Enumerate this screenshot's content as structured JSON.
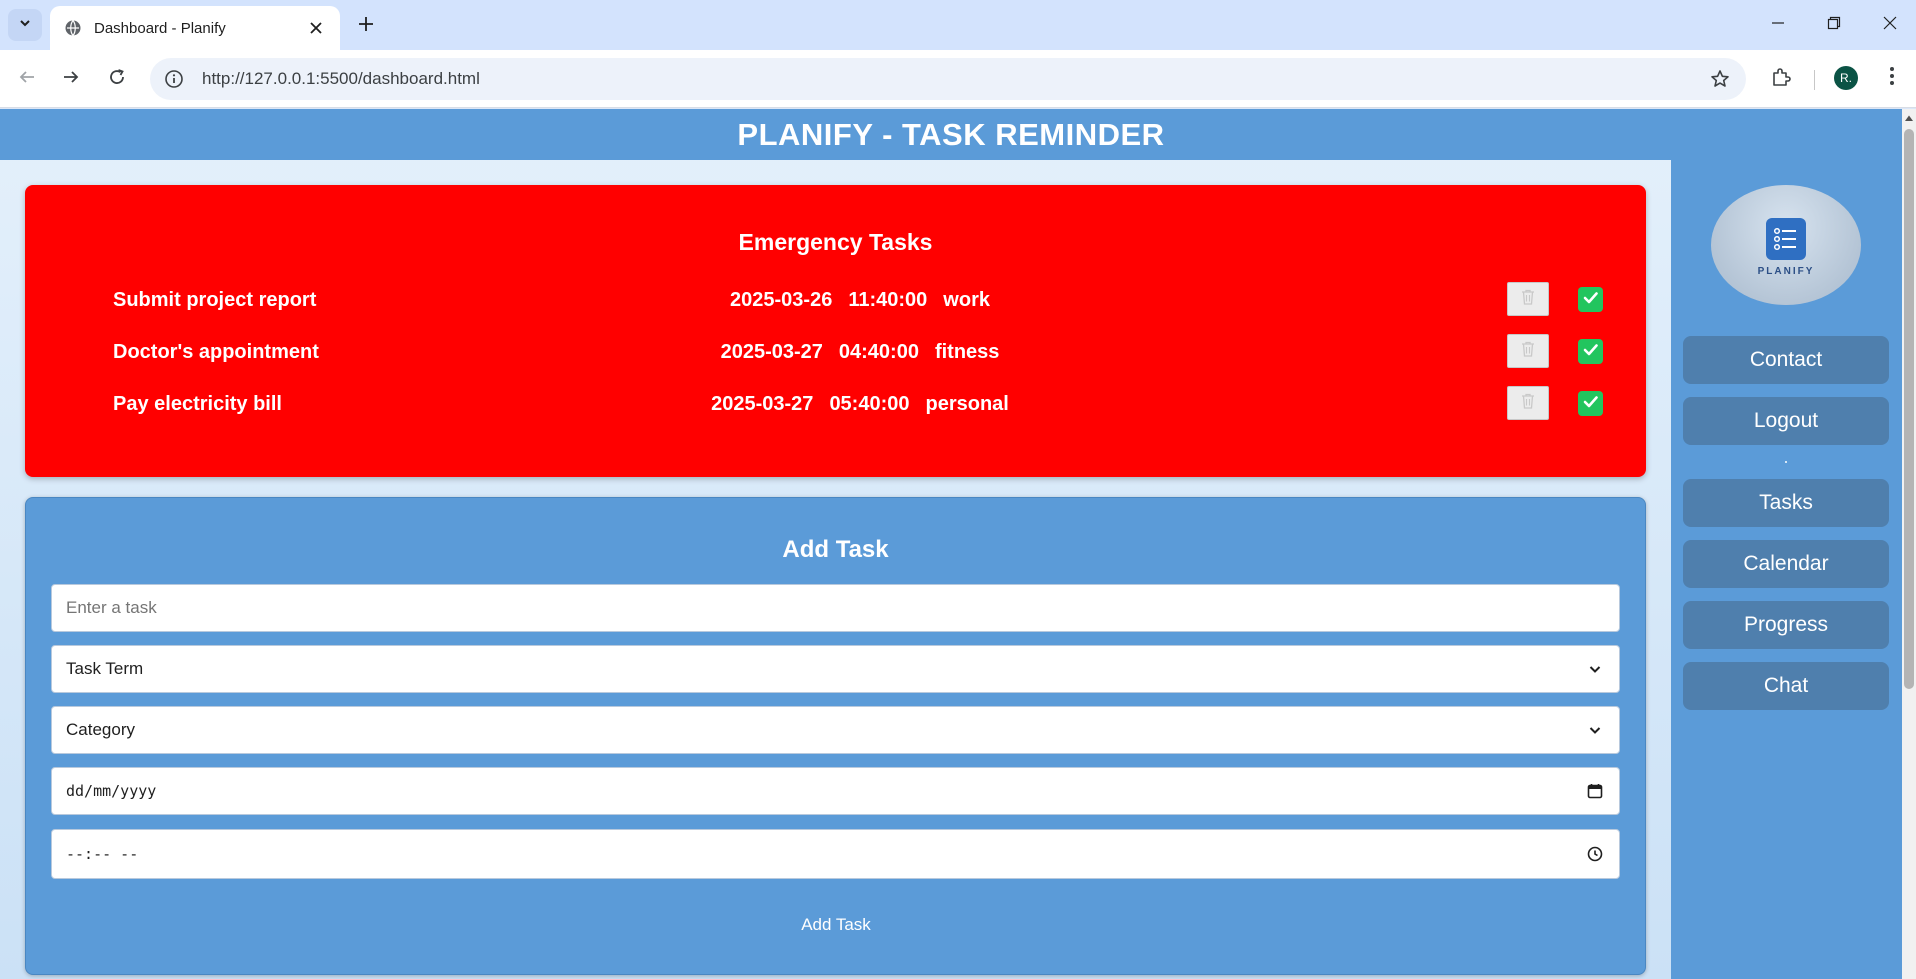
{
  "browser": {
    "tab_title": "Dashboard - Planify",
    "url": "http://127.0.0.1:5500/dashboard.html",
    "profile_initial": "R."
  },
  "header": {
    "title": "PLANIFY - TASK REMINDER"
  },
  "emergency": {
    "title": "Emergency Tasks",
    "tasks": [
      {
        "name": "Submit project report",
        "date": "2025-03-26",
        "time": "11:40:00",
        "category": "work"
      },
      {
        "name": "Doctor's appointment",
        "date": "2025-03-27",
        "time": "04:40:00",
        "category": "fitness"
      },
      {
        "name": "Pay electricity bill",
        "date": "2025-03-27",
        "time": "05:40:00",
        "category": "personal"
      }
    ]
  },
  "add_task": {
    "title": "Add Task",
    "task_placeholder": "Enter a task",
    "term_value": "Task Term",
    "category_value": "Category",
    "date_value": "dd/mm/yyyy",
    "time_value": "--:-- --",
    "submit_label": "Add Task"
  },
  "sidebar": {
    "logo_text": "PLANIFY",
    "items": [
      {
        "label": "Contact"
      },
      {
        "label": "Logout"
      },
      {
        "label": "Tasks"
      },
      {
        "label": "Calendar"
      },
      {
        "label": "Progress"
      },
      {
        "label": "Chat"
      }
    ]
  },
  "colors": {
    "header_blue": "#5b9bd8",
    "emergency_red": "#ff0000",
    "sidebar_button": "#4f7fad",
    "check_green": "#22c55e"
  },
  "icons": [
    "tab-search-icon",
    "globe-icon",
    "close-icon",
    "plus-icon",
    "minimize-icon",
    "restore-icon",
    "back-icon",
    "forward-icon",
    "reload-icon",
    "info-icon",
    "star-icon",
    "extensions-icon",
    "more-vert-icon",
    "trash-icon",
    "check-icon",
    "chevron-down-icon",
    "calendar-icon",
    "clock-icon"
  ]
}
